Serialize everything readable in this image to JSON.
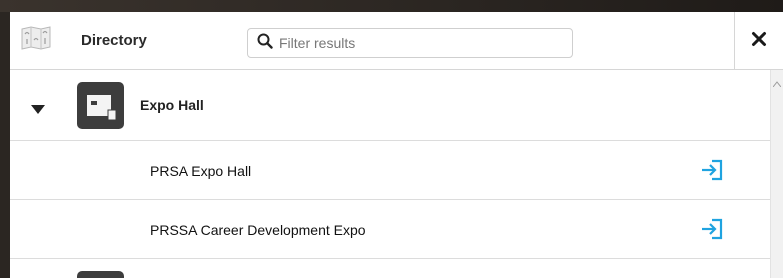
{
  "header": {
    "title": "Directory",
    "search_placeholder": "Filter results"
  },
  "icons": {
    "header": "map-icon",
    "search": "search-icon",
    "close": "close-icon",
    "expand": "caret-down-icon",
    "category": "expo-hall-icon",
    "go": "enter-icon"
  },
  "colors": {
    "accent": "#1fa3e0",
    "category_icon_bg": "#3d3d3d"
  },
  "directory": {
    "category": {
      "label": "Expo Hall",
      "expanded": true,
      "items": [
        {
          "label": "PRSA Expo Hall"
        },
        {
          "label": "PRSSA Career Development Expo"
        }
      ]
    }
  }
}
